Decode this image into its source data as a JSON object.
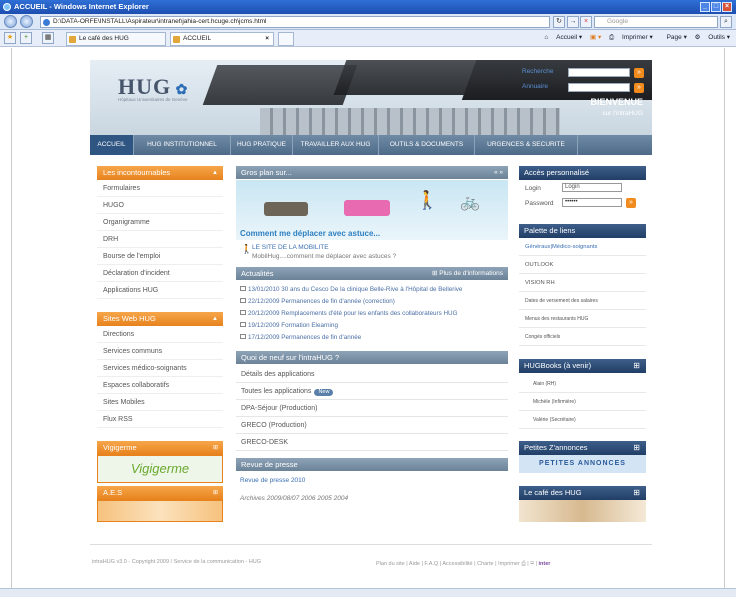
{
  "window": {
    "title": "ACCUEIL - Windows Internet Explorer"
  },
  "browser": {
    "address": "D:\\DATA-ORFE\\INSTALL\\Aspirateur\\intranet\\jahia-cert.hcuge.ch\\jcms.html",
    "search_placeholder": "Google",
    "tabs": [
      "Le café des HUG",
      "ACCUEIL"
    ],
    "commands": {
      "home": "Accueil",
      "print": "Imprimer",
      "page": "Page",
      "tools": "Outils"
    }
  },
  "header": {
    "logo": "HUG",
    "logo_sub": "Hôpitaux Universitaires de Genève",
    "search_label": "Recherche",
    "annuaire_label": "Annuaire",
    "welcome": "BIENVENUE",
    "welcome_sub": "sur l'intraHUG"
  },
  "nav": [
    "ACCUEIL",
    "HUG INSTITUTIONNEL",
    "HUG PRATIQUE",
    "TRAVAILLER AUX HUG",
    "OUTILS & DOCUMENTS",
    "URGENCES & SECURITE"
  ],
  "left": {
    "incontournables_title": "Les incontournables",
    "incontournables": [
      "Formulaires",
      "HUGO",
      "Organigramme",
      "DRH",
      "Bourse de l'emploi",
      "Déclaration d'incident",
      "Applications HUG"
    ],
    "sites_title": "Sites Web HUG",
    "sites": [
      "Directions",
      "Services communs",
      "Services médico-soignants",
      "Espaces collaboratifs",
      "Sites Mobiles",
      "Flux RSS"
    ],
    "vigiger_title": "Vigigerme",
    "vigiger_logo": "Vigigerme",
    "aes_title": "A.E.S"
  },
  "center": {
    "plan_title": "Gros plan sur...",
    "plan_nav": "« »",
    "banner_title": "Comment me déplacer avec astuce...",
    "mob_title": "LE SITE DE LA MOBILITE",
    "mob_text": "MobilHug....comment me déplacer avec astuces ?",
    "actu_title": "Actualités",
    "actu_more": "Plus de d'informations",
    "news": [
      "13/01/2010 30 ans du Cesco De la clinique Belle-Rive à l'Hôpital de Bellerive",
      "22/12/2009 Permanences de fin d'année (correction)",
      "20/12/2009 Remplacements d'été pour les enfants des collaborateurs HUG",
      "19/12/2009 Formation Elearning",
      "17/12/2009 Permanences de fin d'année"
    ],
    "quoi_title": "Quoi de neuf sur l'intraHUG ?",
    "quoi": [
      "Détails des applications",
      "Toutes les applications",
      "DPA-Séjour (Production)",
      "GRECO (Production)",
      "GRECO-DESK"
    ],
    "new_badge": "New",
    "revue_title": "Revue de presse",
    "revue_link": "Revue de presse 2010",
    "archives": "Archives 2009/08/07 2006 2005 2004"
  },
  "right": {
    "acces_title": "Accès personnalisé",
    "login_label": "Login",
    "login_value": "Login",
    "password_label": "Password",
    "password_value": "••••••",
    "palette_title": "Palette de liens",
    "palette_tabs": "Généraux|Médico-soignants",
    "palette": [
      "OUTLOOK",
      "VISION RH",
      "Dates de versement des salaires",
      "Menus des restaurants HUG",
      "Congés officiels"
    ],
    "books_title": "HUGBooks (à venir)",
    "books": [
      "Alain (RH)",
      "Michèle (Infirmière)",
      "Valérie (Secrétaire)"
    ],
    "annonces_title": "Petites Z'annonces",
    "annonces_text": "PETITES ANNONCES",
    "cafe_title": "Le café des HUG"
  },
  "footer": {
    "left": "intraHUG v3.0 - Copyright 2009 / Service de la communication - HUG",
    "right": "Plan du site | Aide | F.A.Q | Accessibilité | Charte | Imprimer",
    "brand": "inter"
  }
}
